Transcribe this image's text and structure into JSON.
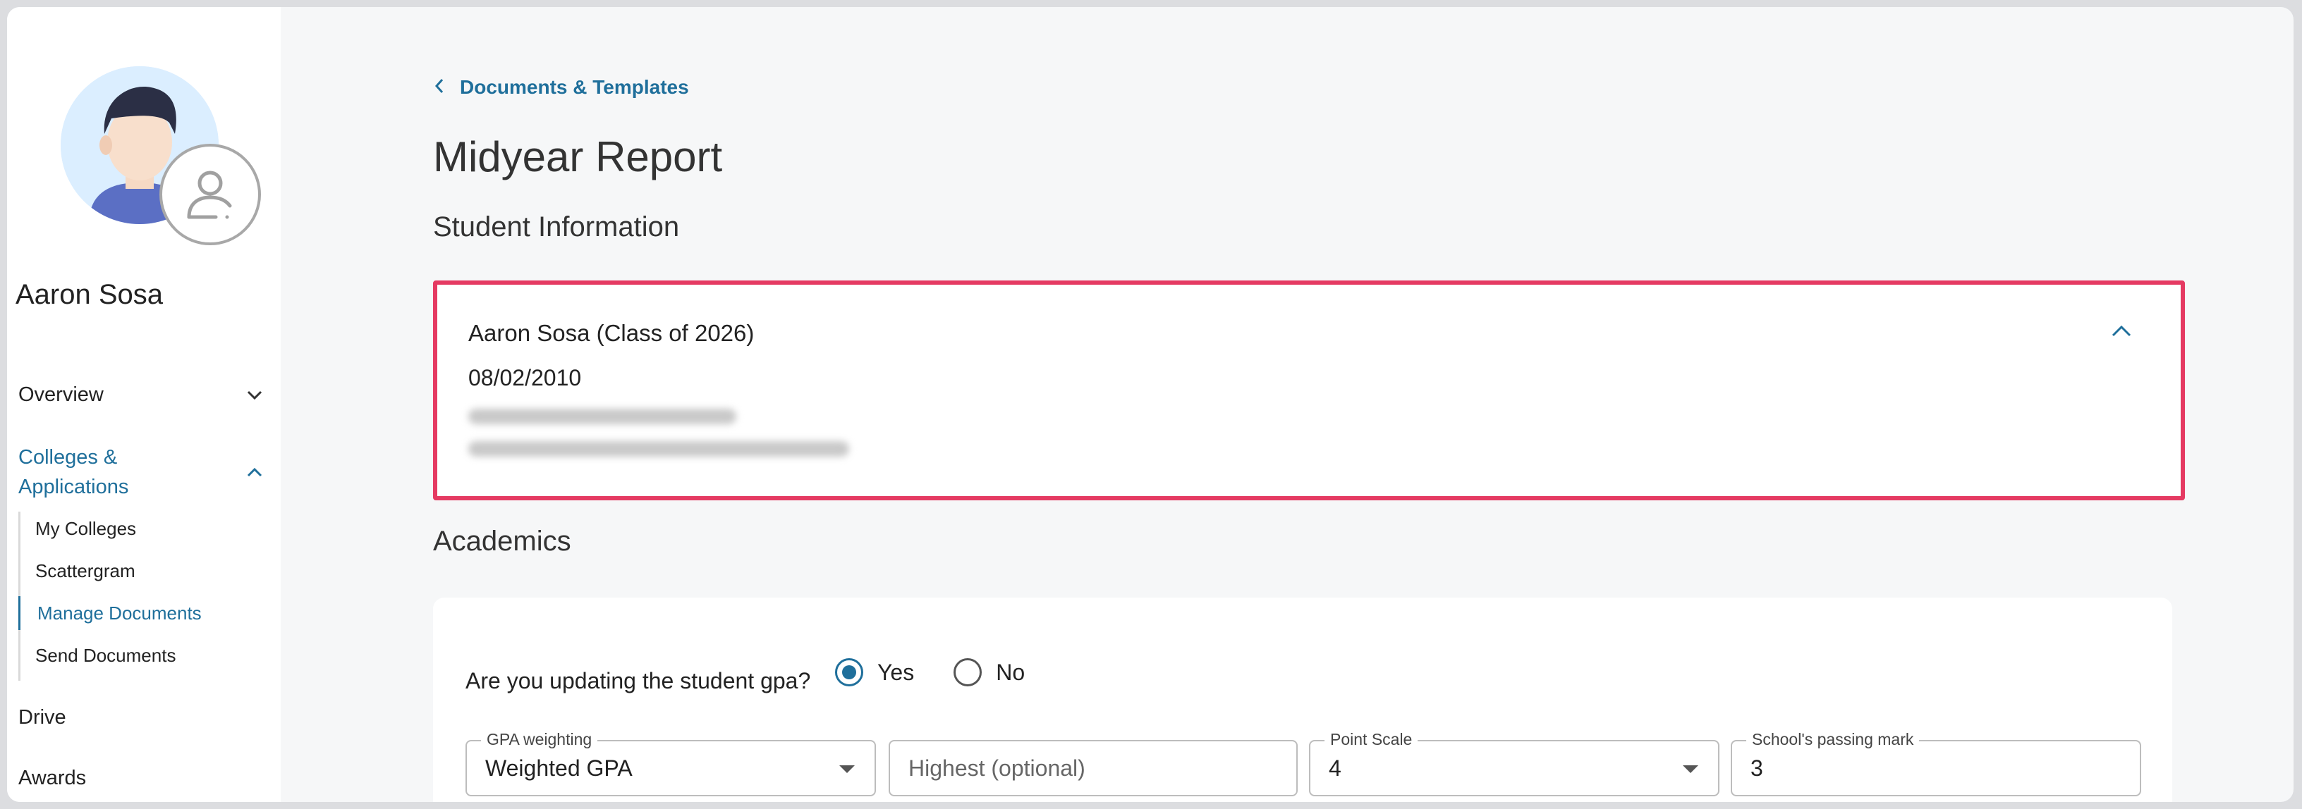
{
  "sidebar": {
    "student_name": "Aaron Sosa",
    "nav": {
      "overview": "Overview",
      "colleges": "Colleges & Applications",
      "drive": "Drive",
      "awards": "Awards"
    },
    "subnav": [
      "My Colleges",
      "Scattergram",
      "Manage Documents",
      "Send Documents"
    ],
    "active_subnav": "Manage Documents"
  },
  "breadcrumb": {
    "label": "Documents & Templates",
    "icon": "chevron-left-icon"
  },
  "page": {
    "title": "Midyear Report"
  },
  "student_info": {
    "section_title": "Student Information",
    "header": "Aaron Sosa (Class of 2026)",
    "dob": "08/02/2010"
  },
  "academics": {
    "section_title": "Academics",
    "question": "Are you updating the student gpa?",
    "options": {
      "yes": "Yes",
      "no": "No"
    },
    "selected": "Yes",
    "fields": {
      "gpa_weighting": {
        "label": "GPA weighting",
        "value": "Weighted GPA"
      },
      "highest": {
        "placeholder": "Highest (optional)"
      },
      "point_scale": {
        "label": "Point Scale",
        "value": "4"
      },
      "passing_mark": {
        "label": "School's passing mark",
        "value": "3"
      }
    }
  },
  "colors": {
    "accent": "#1f6f9b",
    "highlight_border": "#e53a62"
  }
}
